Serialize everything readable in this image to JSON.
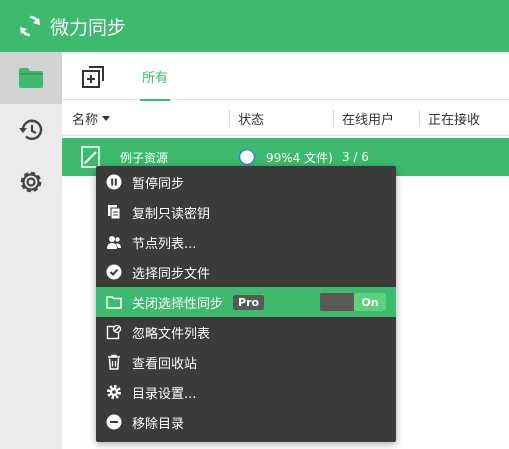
{
  "app": {
    "title": "微力同步",
    "accent_color": "#3dba6d",
    "logo_icon": "sync-logo-icon"
  },
  "sidebar": {
    "items": [
      {
        "name": "folders",
        "icon": "folder-icon",
        "active": true
      },
      {
        "name": "history",
        "icon": "history-icon",
        "active": false
      },
      {
        "name": "settings",
        "icon": "gear-icon",
        "active": false
      }
    ]
  },
  "toolbar": {
    "add_icon": "add-folder-icon",
    "tab_all": "所有"
  },
  "table": {
    "columns": {
      "name": "名称",
      "status": "状态",
      "online_users": "在线用户",
      "receiving": "正在接收"
    },
    "rows": [
      {
        "name": "例子资源",
        "status": "99%4 文件)",
        "online_users": "3 / 6",
        "receiving": ""
      }
    ]
  },
  "context_menu": {
    "items": [
      {
        "label": "暂停同步",
        "icon": "pause-icon"
      },
      {
        "label": "复制只读密钥",
        "icon": "copy-icon"
      },
      {
        "label": "节点列表...",
        "icon": "users-icon"
      },
      {
        "label": "选择同步文件",
        "icon": "check-circle-icon"
      },
      {
        "label": "关闭选择性同步",
        "icon": "folder-outline-icon",
        "highlighted": true,
        "badge": "Pro",
        "toggle": "On"
      },
      {
        "label": "忽略文件列表",
        "icon": "ignore-icon"
      },
      {
        "label": "查看回收站",
        "icon": "trash-icon"
      },
      {
        "label": "目录设置...",
        "icon": "gear-icon"
      },
      {
        "label": "移除目录",
        "icon": "remove-icon"
      }
    ]
  }
}
